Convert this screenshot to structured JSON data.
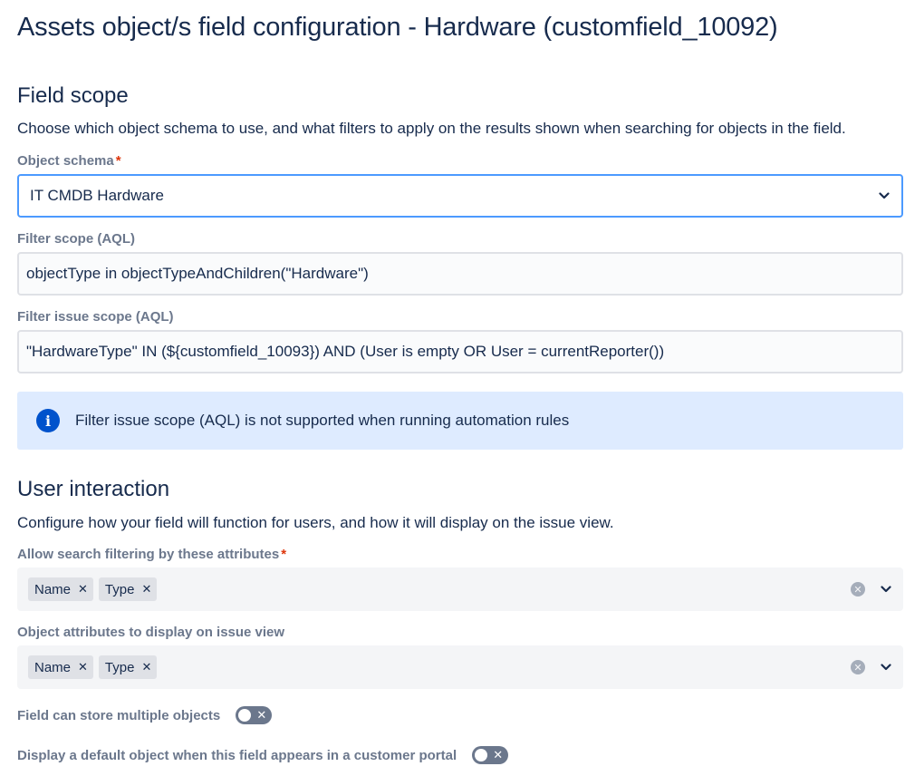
{
  "page_title": "Assets object/s field configuration - Hardware (customfield_10092)",
  "field_scope": {
    "title": "Field scope",
    "description": "Choose which object schema to use, and what filters to apply on the results shown when searching for objects in the field.",
    "object_schema_label": "Object schema",
    "required_marker": "*",
    "object_schema_value": "IT CMDB Hardware",
    "filter_scope_label": "Filter scope (AQL)",
    "filter_scope_value": "objectType in objectTypeAndChildren(\"Hardware\")",
    "filter_issue_scope_label": "Filter issue scope (AQL)",
    "filter_issue_scope_value": "\"HardwareType\" IN (${customfield_10093}) AND (User is empty OR User = currentReporter())",
    "banner_icon": "info-icon",
    "banner_text": "Filter issue scope (AQL) is not supported when running automation rules"
  },
  "user_interaction": {
    "title": "User interaction",
    "description": "Configure how your field will function for users, and how it will display on the issue view.",
    "search_filter_label": "Allow search filtering by these attributes",
    "search_filter_tags": [
      "Name",
      "Type"
    ],
    "display_attrs_label": "Object attributes to display on issue view",
    "display_attrs_tags": [
      "Name",
      "Type"
    ],
    "multiple_objects_label": "Field can store multiple objects",
    "multiple_objects_enabled": false,
    "default_object_label": "Display a default object when this field appears in a customer portal",
    "default_object_enabled": false
  },
  "colors": {
    "text": "#172B4D",
    "label": "#6B778C",
    "focus_border": "#4C9AFF",
    "banner_bg": "#DEEBFF",
    "info_icon": "#0052CC",
    "required": "#DE350B",
    "toggle_off": "#6B778C"
  }
}
